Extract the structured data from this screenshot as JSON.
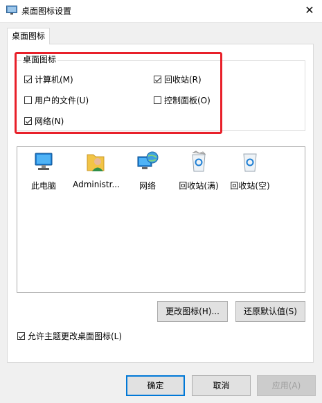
{
  "window": {
    "title": "桌面图标设置"
  },
  "tabs": [
    {
      "label": "桌面图标"
    }
  ],
  "groupbox": {
    "label": "桌面图标",
    "checkboxes": [
      {
        "label": "计算机(M)",
        "checked": true
      },
      {
        "label": "回收站(R)",
        "checked": true
      },
      {
        "label": "用户的文件(U)",
        "checked": false
      },
      {
        "label": "控制面板(O)",
        "checked": false
      },
      {
        "label": "网络(N)",
        "checked": true
      }
    ]
  },
  "icons": [
    {
      "label": "此电脑",
      "icon": "computer-icon"
    },
    {
      "label": "Administr...",
      "icon": "user-folder-icon"
    },
    {
      "label": "网络",
      "icon": "network-icon"
    },
    {
      "label": "回收站(满)",
      "icon": "recycle-bin-full-icon"
    },
    {
      "label": "回收站(空)",
      "icon": "recycle-bin-empty-icon"
    }
  ],
  "buttons": {
    "change_icon": "更改图标(H)...",
    "restore_default": "还原默认值(S)",
    "ok": "确定",
    "cancel": "取消",
    "apply": "应用(A)"
  },
  "allow_theme": {
    "label": "允许主题更改桌面图标(L)",
    "checked": true
  },
  "colors": {
    "highlight": "#e8202a",
    "focus": "#0078d7"
  }
}
